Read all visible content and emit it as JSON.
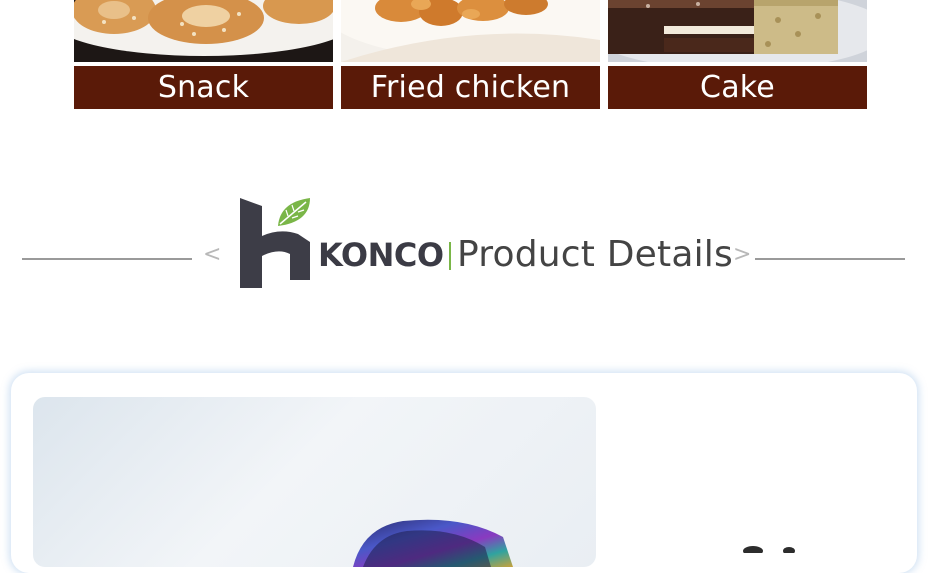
{
  "categories": [
    {
      "label": "Snack",
      "icon": "sesame-snack-photo"
    },
    {
      "label": "Fried chicken",
      "icon": "fried-chicken-photo"
    },
    {
      "label": "Cake",
      "icon": "layer-cake-photo"
    }
  ],
  "heading": {
    "brand": "KONCO",
    "title": "Product Details",
    "prev_arrow": "<",
    "next_arrow": ">",
    "logo_icon": "konco-leaf-logo-icon"
  },
  "colors": {
    "label_bg": "#5a1a08",
    "brand_text": "#3b3b45",
    "leaf_green": "#7ab648",
    "rule_gray": "#9a9a9a"
  },
  "product_card": {
    "image": "rainbow-metal-product-photo"
  }
}
